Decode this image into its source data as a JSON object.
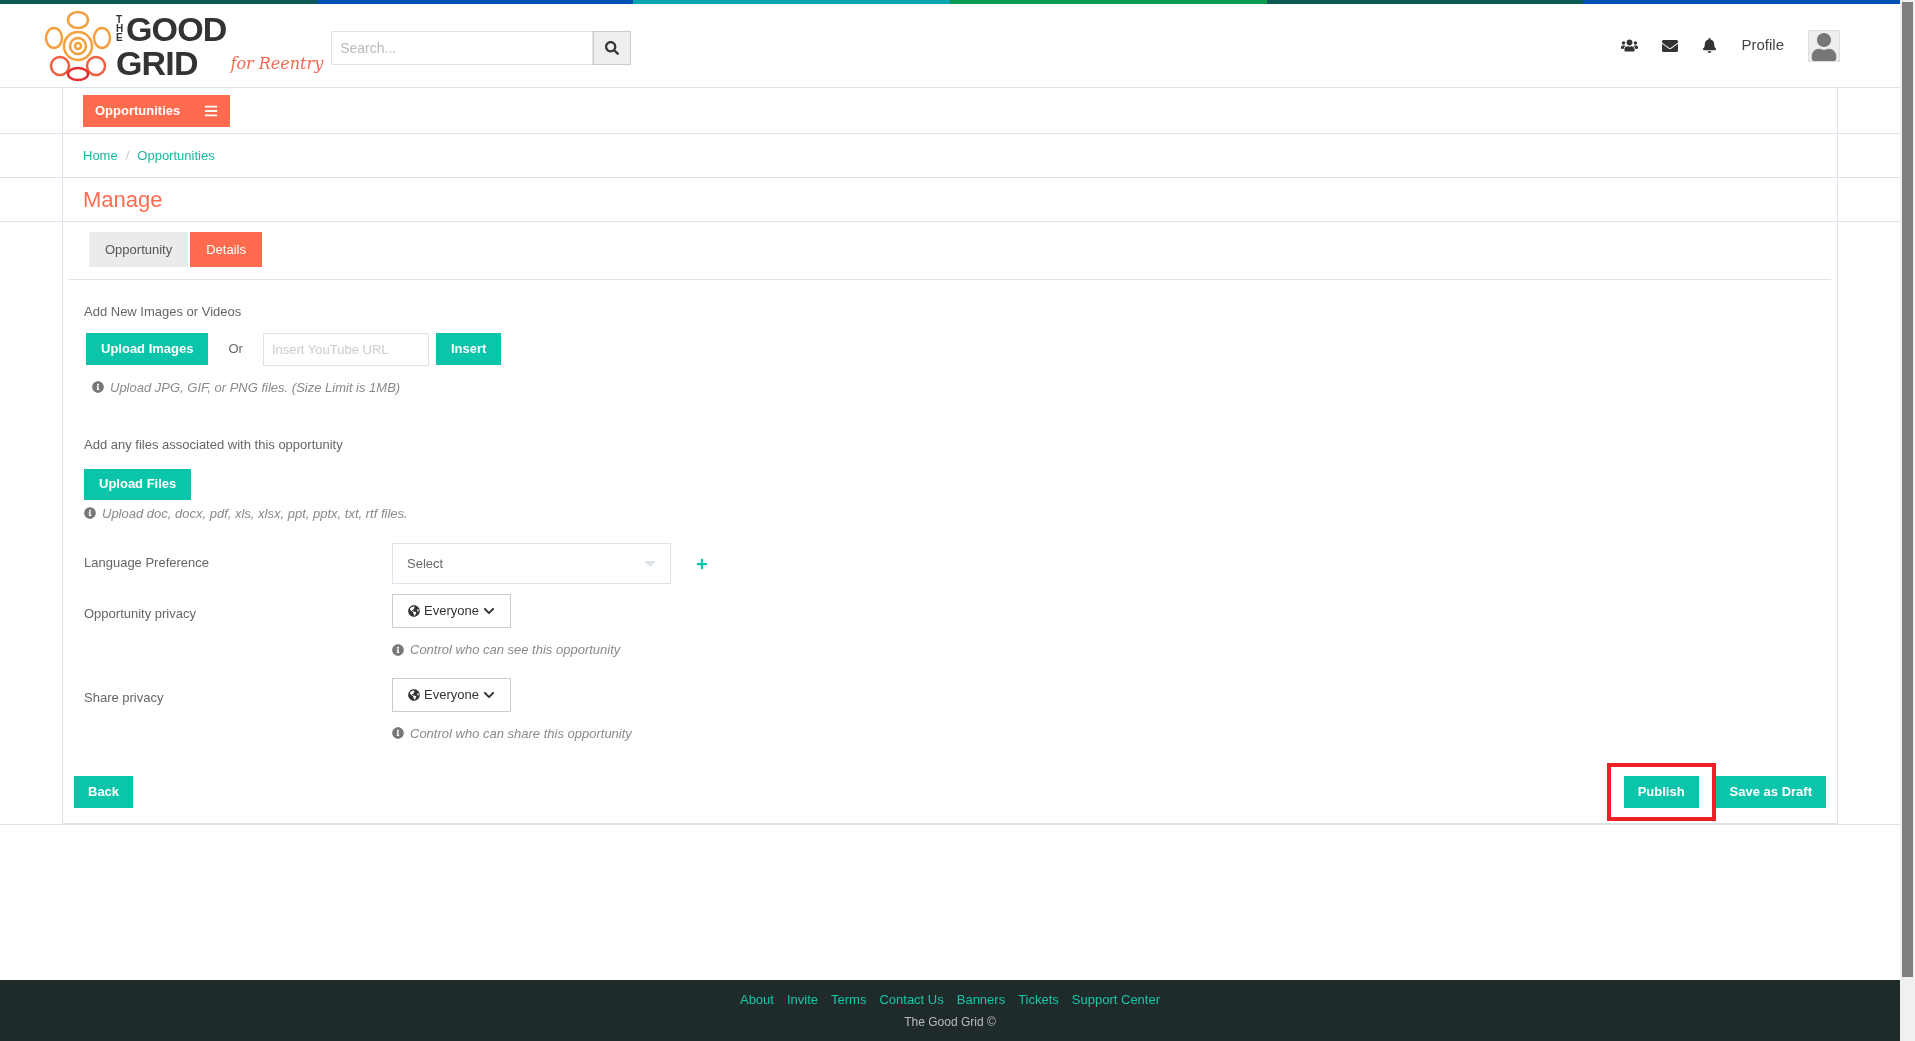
{
  "logo": {
    "small": "THE",
    "line1": "GOOD",
    "line2": "GRID",
    "tagline": "for Reentry"
  },
  "search": {
    "placeholder": "Search..."
  },
  "header_links": [
    {
      "kind": "people"
    },
    {
      "kind": "mail"
    },
    {
      "kind": "bell"
    },
    {
      "kind": "text",
      "label": "Profile"
    },
    {
      "kind": "avatar"
    }
  ],
  "section_menu": {
    "label": "Opportunities"
  },
  "breadcrumb": {
    "items": [
      "Home",
      "Opportunities"
    ],
    "separator": "/"
  },
  "page_title": "Manage",
  "tabs": [
    {
      "label": "Opportunity",
      "selected": false
    },
    {
      "label": "Details",
      "selected": true
    }
  ],
  "media": {
    "label": "Add New Images or Videos",
    "upload_button": "Upload Images",
    "or": "Or",
    "url_placeholder": "Insert YouTube URL",
    "insert_button": "Insert",
    "hint": "Upload JPG, GIF, or PNG files. (Size Limit is 1MB)"
  },
  "files": {
    "label": "Add any files associated with this opportunity",
    "upload_button": "Upload Files",
    "hint": "Upload doc, docx, pdf, xls, xlsx, ppt, pptx, txt, rtf files."
  },
  "fields": [
    {
      "kind": "select",
      "label": "Language Preference",
      "value": "Select"
    },
    {
      "kind": "privacy",
      "label": "Opportunity privacy",
      "value": "Everyone",
      "hint": "Control who can see this opportunity"
    },
    {
      "kind": "privacy",
      "label": "Share privacy",
      "value": "Everyone",
      "hint": "Control who can share this opportunity"
    }
  ],
  "back_button": "Back",
  "actions": [
    {
      "label": "Publish",
      "highlighted": true
    },
    {
      "label": "Save as Draft",
      "highlighted": false
    }
  ],
  "footer": {
    "links": [
      "About",
      "Invite",
      "Terms",
      "Contact Us",
      "Banners",
      "Tickets",
      "Support Center"
    ],
    "copyright": "The Good Grid ©"
  }
}
